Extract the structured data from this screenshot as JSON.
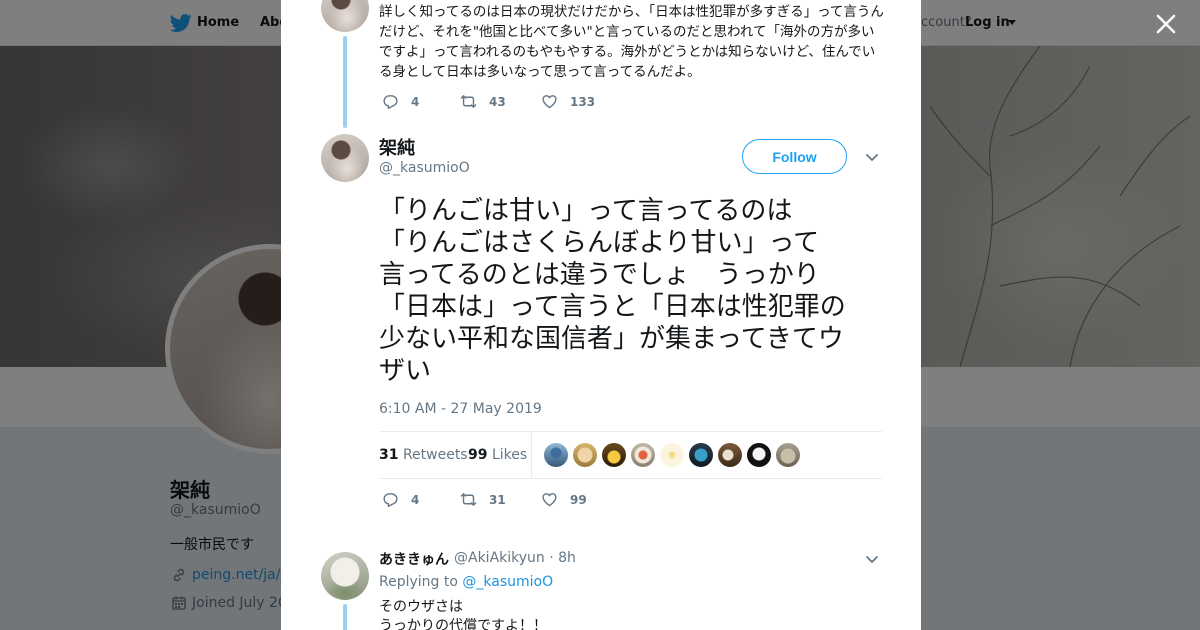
{
  "nav": {
    "home_label": "Home",
    "about_label": "Abo",
    "account_text": "ccount?",
    "login_label": "Log in"
  },
  "profile": {
    "name": "架純",
    "handle": "@_kasumioO",
    "bio": "一般市民です",
    "link": "peing.net/ja/_k",
    "joined": "Joined July 20"
  },
  "previous_tweet": {
    "text": "詳しく知ってるのは日本の現状だけだから、「日本は性犯罪が多すぎる」って言うんだけど、それを\"他国と比べて多い\"と言っているのだと思われて「海外の方が多いですよ」って言われるのもやもやする。海外がどうとかは知らないけど、住んでいる身として日本は多いなって思って言ってるんだよ。",
    "replies": "4",
    "retweets": "43",
    "likes": "133"
  },
  "main_tweet": {
    "author_name": "架純",
    "author_handle": "@_kasumioO",
    "follow_label": "Follow",
    "text": "「りんごは甘い」って言ってるのは\n「りんごはさくらんぼより甘い」って\n言ってるのとは違うでしょ　うっかり\n「日本は」って言うと「日本は性犯罪の\n少ない平和な国信者」が集まってきてウ\nザい",
    "timestamp": "6:10 AM - 27 May 2019",
    "retweet_count": "31",
    "retweet_label": "Retweets",
    "like_count": "99",
    "like_label": "Likes",
    "replies": "4",
    "retweets": "31",
    "likes": "99"
  },
  "reply_tweet": {
    "author_name": "あききゅん",
    "author_handle": "@AkiAkikyun · 8h",
    "replying_prefix": "Replying to",
    "replying_to": "@_kasumioO",
    "text_line1": "そのウザさは",
    "text_line2": "うっかりの代償ですよ！！"
  },
  "likers": [
    "liker-1",
    "liker-2",
    "liker-3",
    "liker-4",
    "liker-5",
    "liker-6",
    "liker-7",
    "liker-8",
    "liker-9"
  ],
  "colors": {
    "accent": "#1da1f2",
    "link": "#1b95e0",
    "thread_line": "#9ad0f6",
    "muted": "#657786"
  }
}
